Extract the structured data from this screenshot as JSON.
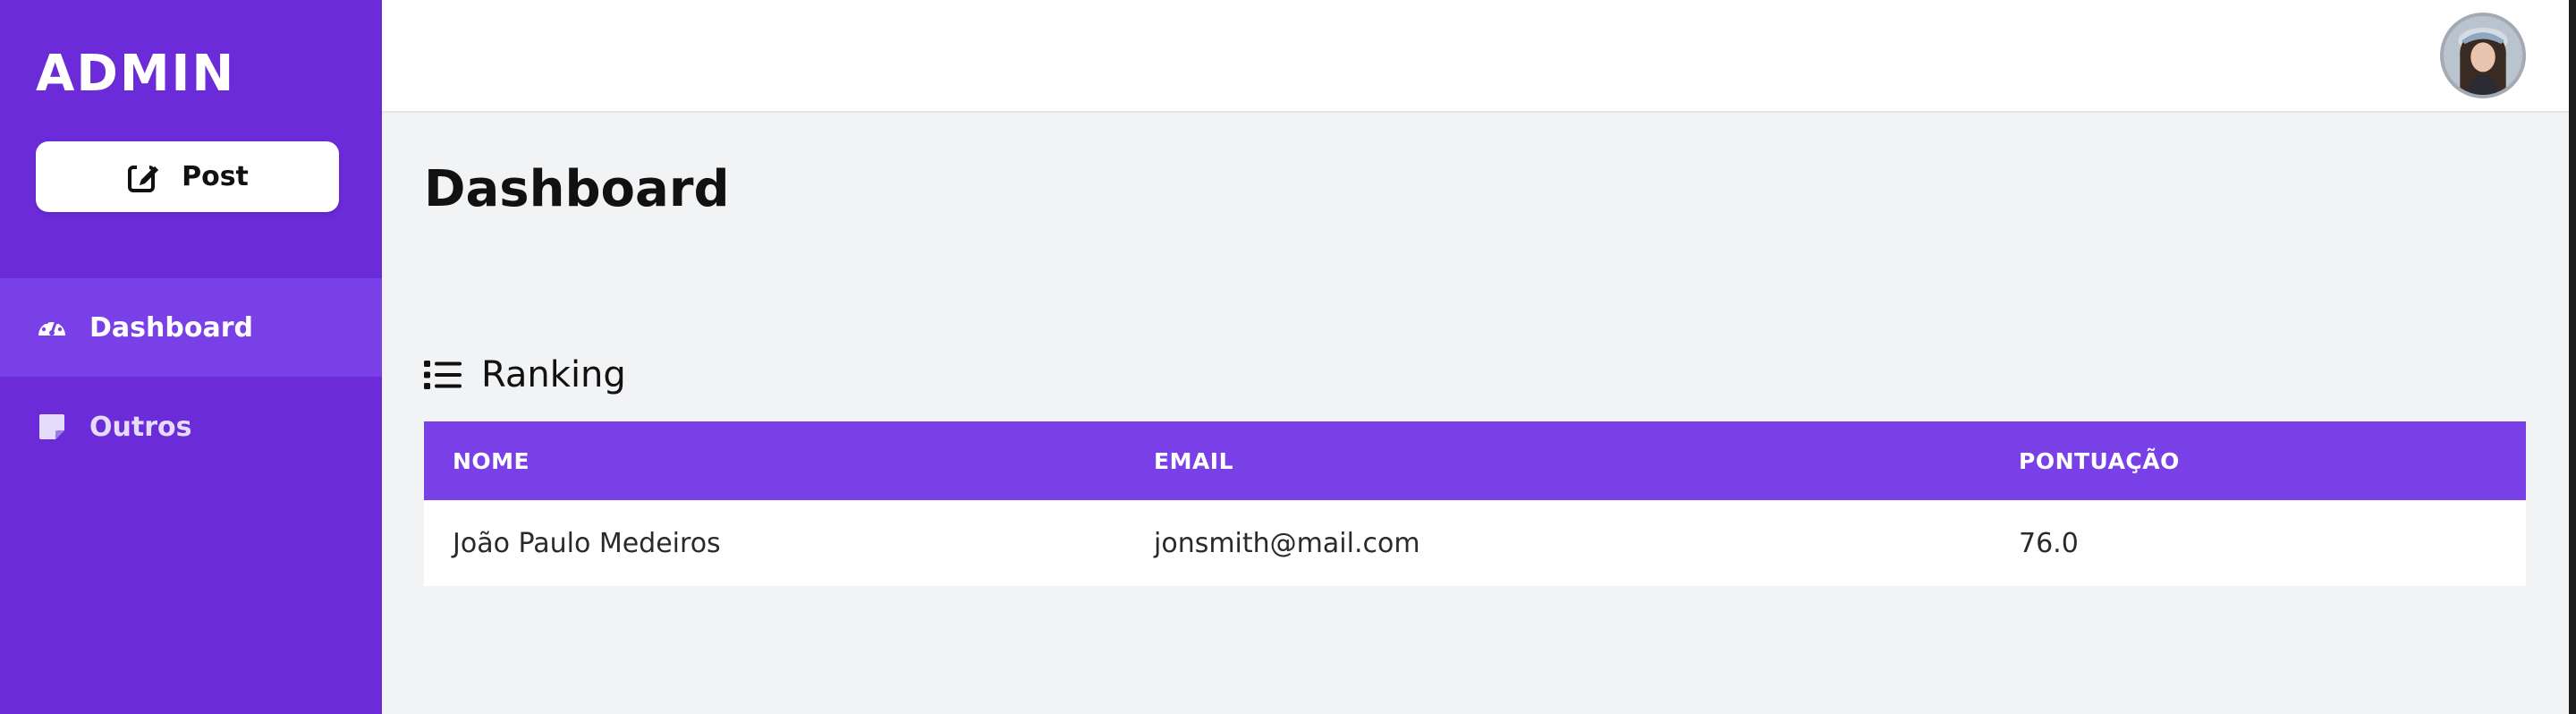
{
  "sidebar": {
    "brand": "ADMIN",
    "post_button": {
      "label": "Post",
      "icon": "edit-icon"
    },
    "items": [
      {
        "label": "Dashboard",
        "icon": "gauge-icon",
        "active": true
      },
      {
        "label": "Outros",
        "icon": "sticky-note-icon",
        "active": false
      }
    ]
  },
  "header": {
    "avatar": "user-avatar"
  },
  "main": {
    "title": "Dashboard",
    "ranking": {
      "title": "Ranking",
      "icon": "list-icon",
      "columns": [
        "NOME",
        "EMAIL",
        "PONTUAÇÃO"
      ],
      "rows": [
        [
          "João Paulo Medeiros",
          "jonsmith@mail.com",
          "76.0"
        ]
      ]
    }
  },
  "colors": {
    "sidebar_bg": "#6c2bd9",
    "active_item_bg": "#7a40e8",
    "table_header_bg": "#7a40e8",
    "page_bg": "#f2f3f5"
  }
}
